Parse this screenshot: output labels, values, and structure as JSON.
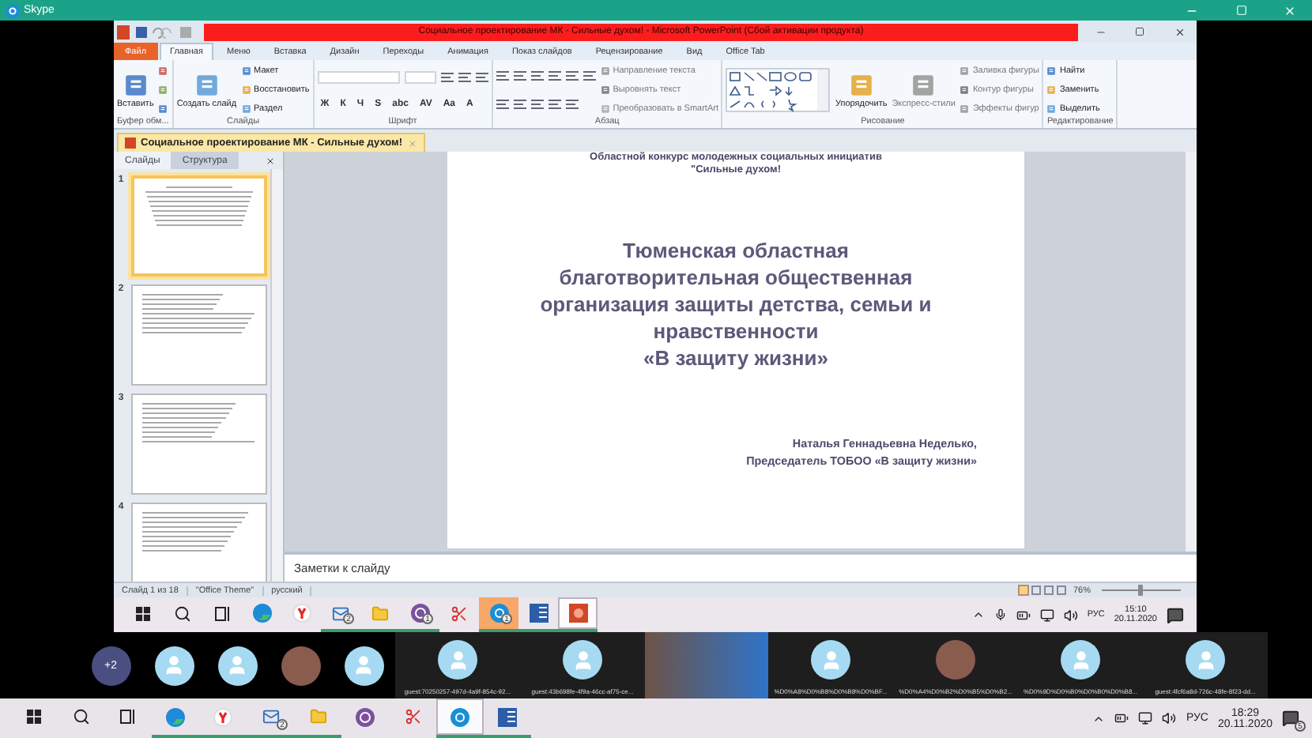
{
  "skype": {
    "title": "Skype"
  },
  "powerpoint": {
    "title": "Социальное проектирование МК - Сильные духом! - Microsoft PowerPoint (Сбой активации продукта)",
    "tabs": [
      {
        "label": "Файл",
        "kind": "file",
        "selected": false
      },
      {
        "label": "Главная",
        "kind": "tab",
        "selected": true
      },
      {
        "label": "Меню",
        "kind": "tab",
        "selected": false
      },
      {
        "label": "Вставка",
        "kind": "tab",
        "selected": false
      },
      {
        "label": "Дизайн",
        "kind": "tab",
        "selected": false
      },
      {
        "label": "Переходы",
        "kind": "tab",
        "selected": false
      },
      {
        "label": "Анимация",
        "kind": "tab",
        "selected": false
      },
      {
        "label": "Показ слайдов",
        "kind": "tab",
        "selected": false
      },
      {
        "label": "Рецензирование",
        "kind": "tab",
        "selected": false
      },
      {
        "label": "Вид",
        "kind": "tab",
        "selected": false
      },
      {
        "label": "Office Tab",
        "kind": "tab",
        "selected": false
      }
    ],
    "ribbon": [
      {
        "label": "Буфер обм...",
        "columns": [
          [
            {
              "kind": "large",
              "label": "Вставить",
              "disabled": false
            }
          ],
          [
            {
              "kind": "icon",
              "disabled": false
            },
            {
              "kind": "icon",
              "disabled": false
            },
            {
              "kind": "icon",
              "disabled": false
            }
          ]
        ]
      },
      {
        "label": "Слайды",
        "columns": [
          [
            {
              "kind": "large",
              "label": "Создать слайд",
              "disabled": false
            }
          ],
          [
            {
              "kind": "small",
              "label": "Макет",
              "disabled": false
            },
            {
              "kind": "small",
              "label": "Восстановить",
              "disabled": false
            },
            {
              "kind": "small",
              "label": "Раздел",
              "disabled": false
            }
          ]
        ]
      },
      {
        "label": "Шрифт",
        "columns": [
          [
            {
              "kind": "font-fields"
            },
            {
              "kind": "glyphs",
              "chars": [
                "Ж",
                "К",
                "Ч",
                "S",
                "abc",
                "AV",
                "Aa",
                "A"
              ]
            }
          ]
        ]
      },
      {
        "label": "Абзац",
        "columns": [
          [
            {
              "kind": "list-tools"
            },
            {
              "kind": "align-tools"
            }
          ],
          [
            {
              "kind": "small",
              "label": "Направление текста",
              "disabled": true
            },
            {
              "kind": "small",
              "label": "Выровнять текст",
              "disabled": true
            },
            {
              "kind": "small",
              "label": "Преобразовать в SmartArt",
              "disabled": true
            }
          ]
        ]
      },
      {
        "label": "Рисование",
        "columns": [
          [
            {
              "kind": "shapes"
            }
          ],
          [
            {
              "kind": "large",
              "label": "Упорядочить",
              "disabled": false
            }
          ],
          [
            {
              "kind": "large",
              "label": "Экспресс-стили",
              "disabled": true
            }
          ],
          [
            {
              "kind": "small",
              "label": "Заливка фигуры",
              "disabled": true
            },
            {
              "kind": "small",
              "label": "Контур фигуры",
              "disabled": true
            },
            {
              "kind": "small",
              "label": "Эффекты фигур",
              "disabled": true
            }
          ]
        ]
      },
      {
        "label": "Редактирование",
        "columns": [
          [
            {
              "kind": "small",
              "label": "Найти",
              "disabled": false
            },
            {
              "kind": "small",
              "label": "Заменить",
              "disabled": false
            },
            {
              "kind": "small",
              "label": "Выделить",
              "disabled": false
            }
          ]
        ]
      }
    ],
    "document_tab": "Социальное проектирование МК - Сильные духом!",
    "pane_tabs": [
      {
        "label": "Слайды",
        "selected": true
      },
      {
        "label": "Структура",
        "selected": false
      }
    ],
    "thumbnails": [
      {
        "number": "1",
        "selected": true
      },
      {
        "number": "2",
        "selected": false
      },
      {
        "number": "3",
        "selected": false
      },
      {
        "number": "4",
        "selected": false
      }
    ],
    "slide": {
      "header_lines": [
        "Областной конкурс  молодежных социальных инициатив",
        "\"Сильные духом!"
      ],
      "title_lines": [
        "Тюменская областная",
        "благотворительная  общественная",
        "организация защиты детства, семьи и",
        "нравственности",
        "«В защиту жизни»"
      ],
      "author_lines": [
        "Наталья Геннадьевна Неделько,",
        "Председатель ТОБОО «В защиту жизни»"
      ]
    },
    "notes_placeholder": "Заметки к слайду",
    "status": {
      "items": [
        "Слайд 1 из 18",
        "\"Office Theme\"",
        "русский"
      ],
      "zoom": "76%",
      "zoom_slider": {
        "level": 0.45
      }
    }
  },
  "shared_taskbar": {
    "apps": [
      {
        "kind": "start",
        "selected": false,
        "attention": false,
        "running": false
      },
      {
        "kind": "search",
        "selected": false,
        "attention": false,
        "running": false
      },
      {
        "kind": "taskview",
        "selected": false,
        "attention": false,
        "running": false
      },
      {
        "kind": "edge",
        "selected": false,
        "attention": false,
        "running": false
      },
      {
        "kind": "yandex",
        "selected": false,
        "attention": false,
        "running": false
      },
      {
        "kind": "mail",
        "badge": "2",
        "selected": false,
        "attention": false,
        "running": true
      },
      {
        "kind": "folder",
        "selected": false,
        "attention": false,
        "running": true
      },
      {
        "kind": "viber",
        "badge": "1",
        "selected": false,
        "attention": false,
        "running": true
      },
      {
        "kind": "scissors",
        "selected": false,
        "attention": false,
        "running": false
      },
      {
        "kind": "skype",
        "badge": "1",
        "selected": false,
        "attention": true,
        "running": true
      },
      {
        "kind": "word",
        "selected": false,
        "attention": false,
        "running": true
      },
      {
        "kind": "powerpoint",
        "selected": true,
        "attention": false,
        "running": true
      }
    ],
    "tray": [
      {
        "kind": "chevron"
      },
      {
        "kind": "mic"
      },
      {
        "kind": "battery"
      },
      {
        "kind": "network"
      },
      {
        "kind": "volume"
      }
    ],
    "language": "РУС",
    "time": "15:10",
    "date": "20.11.2020"
  },
  "participants": [
    {
      "kind": "more",
      "label": "+2"
    },
    {
      "kind": "avatar"
    },
    {
      "kind": "avatar"
    },
    {
      "kind": "photo"
    },
    {
      "kind": "avatar"
    },
    {
      "kind": "avatar",
      "name": "guest:70250257-497d-4a9f-854c-92..."
    },
    {
      "kind": "avatar",
      "name": "guest:43b698fe-4f9a-46cc-af75-ce..."
    },
    {
      "kind": "video"
    },
    {
      "kind": "avatar",
      "name": "%D0%A8%D0%B8%D0%B8%D0%BF..."
    },
    {
      "kind": "photo",
      "name": "%D0%A4%D0%B2%D0%B5%D0%B2..."
    },
    {
      "kind": "avatar",
      "name": "%D0%9D%D0%B0%D0%B0%D0%B8..."
    },
    {
      "kind": "avatar",
      "name": "guest:4fcf6a8d-726c-48fe-8f23-dd..."
    }
  ],
  "taskbar": {
    "apps": [
      {
        "kind": "start",
        "selected": false,
        "attention": false,
        "running": false
      },
      {
        "kind": "search",
        "selected": false,
        "attention": false,
        "running": false
      },
      {
        "kind": "taskview",
        "selected": false,
        "attention": false,
        "running": false
      },
      {
        "kind": "edge",
        "selected": false,
        "attention": false,
        "running": true
      },
      {
        "kind": "yandex",
        "selected": false,
        "attention": false,
        "running": true
      },
      {
        "kind": "mail",
        "badge": "2",
        "selected": false,
        "attention": false,
        "running": true
      },
      {
        "kind": "folder",
        "selected": false,
        "attention": false,
        "running": true
      },
      {
        "kind": "viber",
        "selected": false,
        "attention": false,
        "running": false
      },
      {
        "kind": "scissors",
        "selected": false,
        "attention": false,
        "running": false
      },
      {
        "kind": "skype",
        "selected": true,
        "attention": false,
        "running": true
      },
      {
        "kind": "word",
        "selected": false,
        "attention": false,
        "running": true
      }
    ],
    "tray": [
      {
        "kind": "chevron"
      },
      {
        "kind": "battery"
      },
      {
        "kind": "network"
      },
      {
        "kind": "volume"
      }
    ],
    "language": "РУС",
    "time": "18:29",
    "date": "20.11.2020",
    "notifications": "5"
  }
}
